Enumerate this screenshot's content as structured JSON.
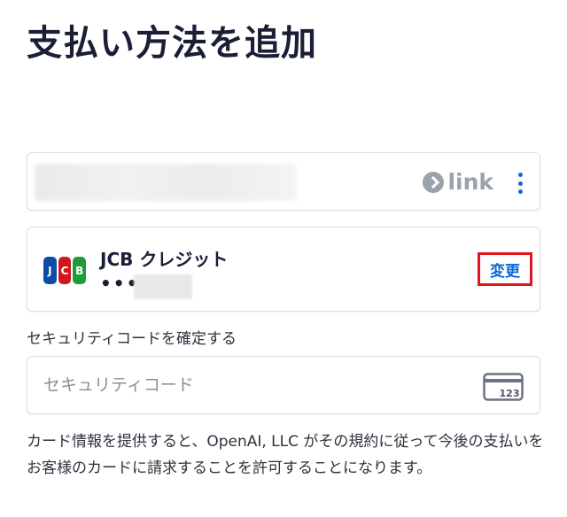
{
  "page": {
    "title": "支払い方法を追加"
  },
  "link_account": {
    "brand_label": "link",
    "menu_icon": "more-vertical-icon"
  },
  "payment_method": {
    "brand_name": "JCB クレジット",
    "masked_number": "••••",
    "logo_letters": [
      "J",
      "C",
      "B"
    ],
    "change_label": "変更"
  },
  "security_code": {
    "label": "セキュリティコードを確定する",
    "placeholder": "セキュリティコード",
    "value": "",
    "icon_text": "123"
  },
  "consent": {
    "text": "カード情報を提供すると、OpenAI, LLC がその規約に従って今後の支払いをお客様のカードに請求することを許可することになります。"
  },
  "colors": {
    "accent": "#0c6ad6",
    "highlight_border": "#e0161e",
    "text_primary": "#1a1f36",
    "border": "#d9dce3"
  }
}
